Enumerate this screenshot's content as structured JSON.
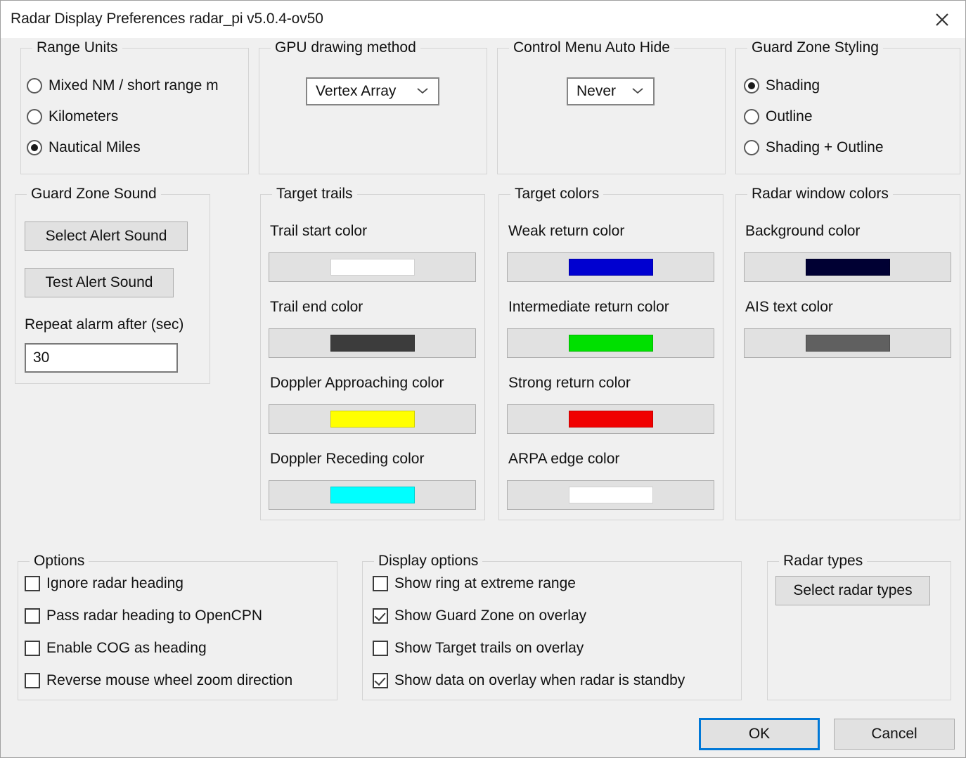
{
  "window": {
    "title": "Radar Display Preferences radar_pi v5.0.4-ov50",
    "close_icon": "close-icon"
  },
  "range_units": {
    "title": "Range Units",
    "options": [
      {
        "label": "Mixed NM / short range m",
        "selected": false
      },
      {
        "label": "Kilometers",
        "selected": false
      },
      {
        "label": "Nautical Miles",
        "selected": true
      }
    ]
  },
  "gpu_drawing_method": {
    "title": "GPU drawing method",
    "value": "Vertex Array"
  },
  "control_menu_auto_hide": {
    "title": "Control Menu Auto Hide",
    "value": "Never"
  },
  "guard_zone_styling": {
    "title": "Guard Zone Styling",
    "options": [
      {
        "label": "Shading",
        "selected": true
      },
      {
        "label": "Outline",
        "selected": false
      },
      {
        "label": "Shading + Outline",
        "selected": false
      }
    ]
  },
  "guard_zone_sound": {
    "title": "Guard Zone Sound",
    "select_alert_sound": "Select Alert Sound",
    "test_alert_sound": "Test Alert Sound",
    "repeat_alarm_label": "Repeat alarm after (sec)",
    "repeat_alarm_value": "30"
  },
  "target_trails": {
    "title": "Target trails",
    "items": [
      {
        "label": "Trail start color",
        "color": "#ffffff"
      },
      {
        "label": "Trail end color",
        "color": "#3c3c3c"
      },
      {
        "label": "Doppler Approaching color",
        "color": "#ffff00"
      },
      {
        "label": "Doppler Receding color",
        "color": "#00ffff"
      }
    ]
  },
  "target_colors": {
    "title": "Target colors",
    "items": [
      {
        "label": "Weak return color",
        "color": "#0000d0"
      },
      {
        "label": "Intermediate return color",
        "color": "#00e000"
      },
      {
        "label": "Strong return color",
        "color": "#f00000"
      },
      {
        "label": "ARPA edge color",
        "color": "#ffffff"
      }
    ]
  },
  "radar_window_colors": {
    "title": "Radar window colors",
    "items": [
      {
        "label": "Background color",
        "color": "#000033"
      },
      {
        "label": "AIS text color",
        "color": "#606060"
      }
    ]
  },
  "options": {
    "title": "Options",
    "items": [
      {
        "label": "Ignore radar heading",
        "checked": false
      },
      {
        "label": "Pass radar heading to OpenCPN",
        "checked": false
      },
      {
        "label": "Enable COG as heading",
        "checked": false
      },
      {
        "label": "Reverse mouse wheel zoom direction",
        "checked": false
      }
    ]
  },
  "display_options": {
    "title": "Display options",
    "items": [
      {
        "label": "Show ring at extreme range",
        "checked": false
      },
      {
        "label": "Show Guard Zone on overlay",
        "checked": true
      },
      {
        "label": "Show Target trails on overlay",
        "checked": false
      },
      {
        "label": "Show data on overlay when radar is standby",
        "checked": true
      }
    ]
  },
  "radar_types": {
    "title": "Radar types",
    "button": "Select radar types"
  },
  "footer": {
    "ok": "OK",
    "cancel": "Cancel"
  },
  "theme": {
    "focus_accent": "#0078d7",
    "window_bg": "#f0f0f0",
    "button_bg": "#e1e1e1"
  }
}
